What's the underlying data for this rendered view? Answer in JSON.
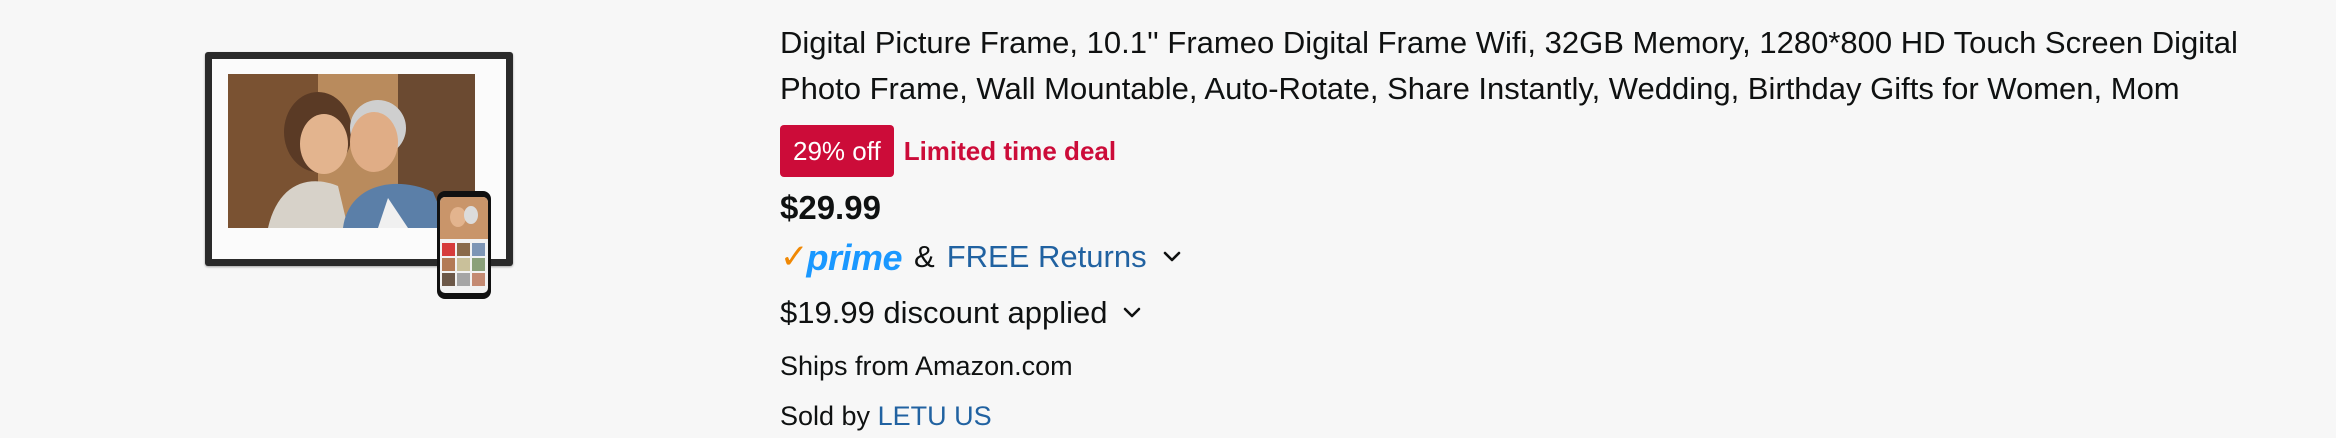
{
  "product": {
    "title": "Digital Picture Frame, 10.1'' Frameo Digital Frame Wifi, 32GB Memory, 1280*800 HD Touch Screen Digital Photo Frame, Wall Mountable, Auto-Rotate, Share Instantly, Wedding, Birthday Gifts for Women, Mom",
    "image_icon": "digital-frame-with-phone-photo"
  },
  "deal": {
    "badge": "29% off",
    "label": "Limited time deal",
    "color": "#cc0c39"
  },
  "price": "$29.99",
  "delivery": {
    "prime_check": "✓",
    "prime_label": "prime",
    "amp": "&",
    "returns_label": "FREE Returns",
    "chevron_icon": "chevron-down-icon"
  },
  "discount": {
    "label": "$19.99 discount applied",
    "chevron_icon": "chevron-down-icon"
  },
  "shipping": {
    "ships_from": "Ships from Amazon.com"
  },
  "seller": {
    "prefix": "Sold by",
    "name": "LETU US",
    "link_color": "#2162a1"
  }
}
